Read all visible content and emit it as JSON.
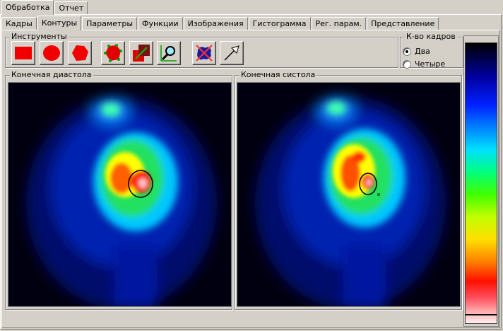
{
  "top_tabs": [
    "Обработка",
    "Отчет"
  ],
  "top_tabs_active": 0,
  "sub_tabs": [
    "Кадры",
    "Контуры",
    "Параметры",
    "Функции",
    "Изображения",
    "Гистограмма",
    "Рег. парам.",
    "Представление"
  ],
  "sub_tabs_active": 1,
  "tools": {
    "label": "Инструменты",
    "buttons": [
      {
        "name": "rect-roi-tool",
        "icon": "red-rectangle-icon"
      },
      {
        "name": "ellipse-roi-tool",
        "icon": "red-ellipse-icon"
      },
      {
        "name": "polygon-roi-tool",
        "icon": "red-polygon-icon"
      },
      {
        "name": "auto-contour-tool",
        "icon": "green-dots-blob-icon"
      },
      {
        "name": "background-roi-tool",
        "icon": "background-roi-icon"
      },
      {
        "name": "zoom-tool",
        "icon": "magnifier-icon"
      },
      {
        "name": "delete-roi-tool",
        "icon": "delete-contour-icon"
      },
      {
        "name": "pointer-tool",
        "icon": "arrow-pointer-icon"
      }
    ]
  },
  "frames": {
    "label": "К-во кадров",
    "options": [
      "Два",
      "Четыре"
    ],
    "selected": 0
  },
  "diastole": {
    "label": "Конечная диастола"
  },
  "systole": {
    "label": "Конечная систола"
  },
  "colors": {
    "window_bg": "#d4d0c8",
    "roi_outline": "#000000"
  }
}
